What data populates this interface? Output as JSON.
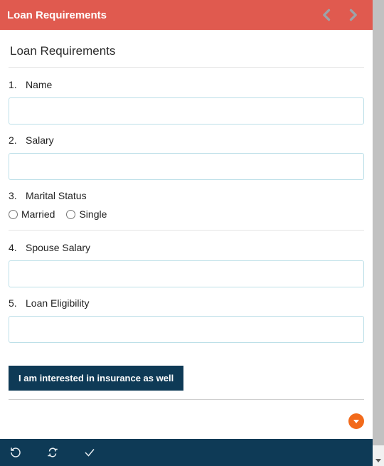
{
  "header": {
    "title": "Loan Requirements"
  },
  "form": {
    "title": "Loan Requirements",
    "questions": [
      {
        "num": "1.",
        "label": "Name",
        "type": "text",
        "value": ""
      },
      {
        "num": "2.",
        "label": "Salary",
        "type": "text",
        "value": ""
      },
      {
        "num": "3.",
        "label": "Marital Status",
        "type": "radio",
        "options": [
          "Married",
          "Single"
        ],
        "value": ""
      },
      {
        "num": "4.",
        "label": "Spouse Salary",
        "type": "text",
        "value": ""
      },
      {
        "num": "5.",
        "label": "Loan Eligibility",
        "type": "text",
        "value": ""
      }
    ],
    "interest_button": "I am interested in insurance as well"
  }
}
